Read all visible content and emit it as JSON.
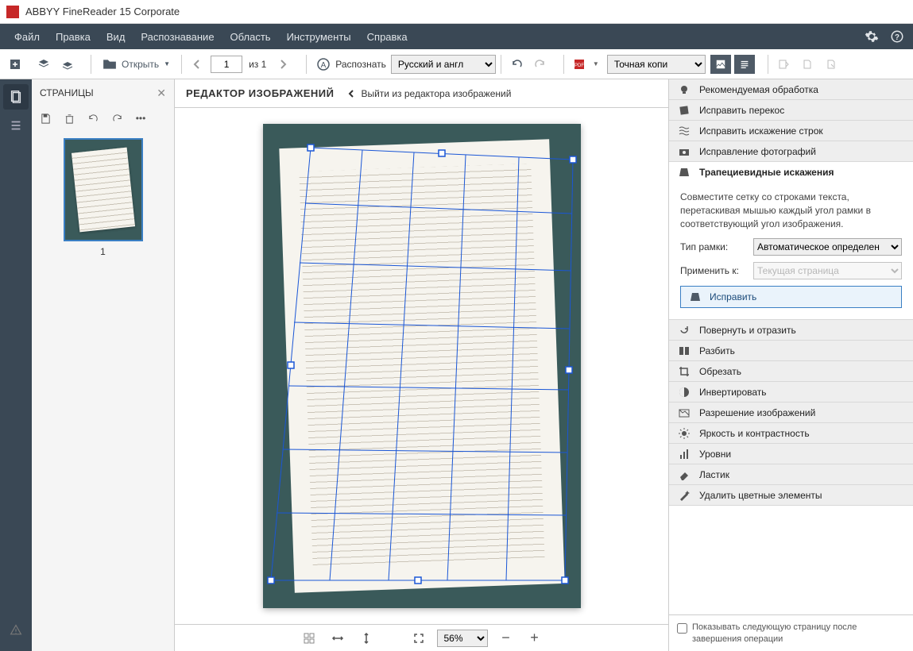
{
  "app": {
    "title": "ABBYY FineReader 15 Corporate"
  },
  "menu": {
    "file": "Файл",
    "edit": "Правка",
    "view": "Вид",
    "recognize": "Распознавание",
    "area": "Область",
    "tools": "Инструменты",
    "help": "Справка"
  },
  "toolbar": {
    "open": "Открыть",
    "page_current": "1",
    "page_of": "из 1",
    "recognize": "Распознать",
    "lang": "Русский и англ",
    "save_mode": "Точная копи"
  },
  "pages_panel": {
    "title": "СТРАНИЦЫ",
    "thumb_num": "1"
  },
  "editor": {
    "title": "РЕДАКТОР ИЗОБРАЖЕНИЙ",
    "back": "Выйти из редактора изображений",
    "zoom": "56%"
  },
  "sidebar": {
    "tools": [
      {
        "id": "recommended",
        "label": "Рекомендуемая обработка"
      },
      {
        "id": "deskew",
        "label": "Исправить перекос"
      },
      {
        "id": "lines",
        "label": "Исправить искажение строк"
      },
      {
        "id": "photo",
        "label": "Исправление фотографий"
      },
      {
        "id": "trapezoid",
        "label": "Трапециевидные искажения"
      },
      {
        "id": "rotate",
        "label": "Повернуть и отразить"
      },
      {
        "id": "split",
        "label": "Разбить"
      },
      {
        "id": "crop",
        "label": "Обрезать"
      },
      {
        "id": "invert",
        "label": "Инвертировать"
      },
      {
        "id": "resolution",
        "label": "Разрешение изображений"
      },
      {
        "id": "brightness",
        "label": "Яркость и контрастность"
      },
      {
        "id": "levels",
        "label": "Уровни"
      },
      {
        "id": "eraser",
        "label": "Ластик"
      },
      {
        "id": "color-remove",
        "label": "Удалить цветные элементы"
      }
    ],
    "trapezoid": {
      "desc": "Совместите сетку со строками текста, перетаскивая мышью каждый угол рамки в соответствующий угол изображения.",
      "frame_type_label": "Тип рамки:",
      "frame_type": "Автоматическое определен",
      "apply_to_label": "Применить к:",
      "apply_to": "Текущая страница",
      "fix": "Исправить"
    },
    "bottom_check": "Показывать следующую страницу после завершения операции"
  }
}
